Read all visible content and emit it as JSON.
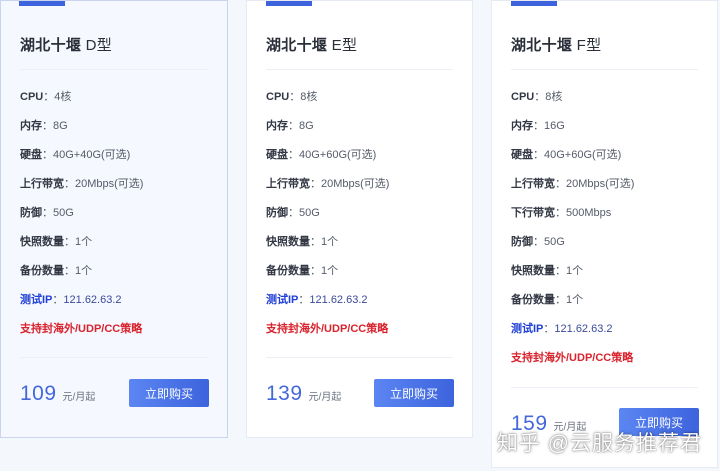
{
  "colors": {
    "accent": "#3d63dd",
    "price": "#4468d9",
    "ip_label": "#1f3fd6",
    "promo": "#d9232d"
  },
  "buy_label": "立即购买",
  "price_unit": "元/月起",
  "cards": [
    {
      "title": "湖北十堰",
      "title_suffix": " D型",
      "specs": [
        {
          "label": "CPU",
          "sep": "：",
          "value": "4核"
        },
        {
          "label": "内存",
          "sep": "：",
          "value": "8G"
        },
        {
          "label": "硬盘",
          "sep": "：",
          "value": "40G+40G(可选)"
        },
        {
          "label": "上行带宽",
          "sep": "：",
          "value": "20Mbps(可选)"
        },
        {
          "label": "防御",
          "sep": "：",
          "value": "50G"
        },
        {
          "label": "快照数量",
          "sep": "：",
          "value": "1个"
        },
        {
          "label": "备份数量",
          "sep": "：",
          "value": "1个"
        },
        {
          "label": "测试IP",
          "sep": "：",
          "value": "121.62.63.2"
        }
      ],
      "promo": "支持封海外/UDP/CC策略",
      "price": "109"
    },
    {
      "title": "湖北十堰",
      "title_suffix": " E型",
      "specs": [
        {
          "label": "CPU",
          "sep": "：",
          "value": "8核"
        },
        {
          "label": "内存",
          "sep": "：",
          "value": "8G"
        },
        {
          "label": "硬盘",
          "sep": "：",
          "value": "40G+60G(可选)"
        },
        {
          "label": "上行带宽",
          "sep": "：",
          "value": "20Mbps(可选)"
        },
        {
          "label": "防御",
          "sep": "：",
          "value": "50G"
        },
        {
          "label": "快照数量",
          "sep": "：",
          "value": "1个"
        },
        {
          "label": "备份数量",
          "sep": "：",
          "value": "1个"
        },
        {
          "label": "测试IP",
          "sep": "：",
          "value": "121.62.63.2"
        }
      ],
      "promo": "支持封海外/UDP/CC策略",
      "price": "139"
    },
    {
      "title": "湖北十堰",
      "title_suffix": " F型",
      "specs": [
        {
          "label": "CPU",
          "sep": "：",
          "value": "8核"
        },
        {
          "label": "内存",
          "sep": "：",
          "value": "16G"
        },
        {
          "label": "硬盘",
          "sep": "：",
          "value": "40G+60G(可选)"
        },
        {
          "label": "上行带宽",
          "sep": "：",
          "value": "20Mbps(可选)"
        },
        {
          "label": "下行带宽",
          "sep": "：",
          "value": "500Mbps"
        },
        {
          "label": "防御",
          "sep": "：",
          "value": "50G"
        },
        {
          "label": "快照数量",
          "sep": "：",
          "value": "1个"
        },
        {
          "label": "备份数量",
          "sep": "：",
          "value": "1个"
        },
        {
          "label": "测试IP",
          "sep": "：",
          "value": "121.62.63.2"
        }
      ],
      "promo": "支持封海外/UDP/CC策略",
      "price": "159"
    }
  ],
  "watermark": "知乎 @云服务推荐君"
}
